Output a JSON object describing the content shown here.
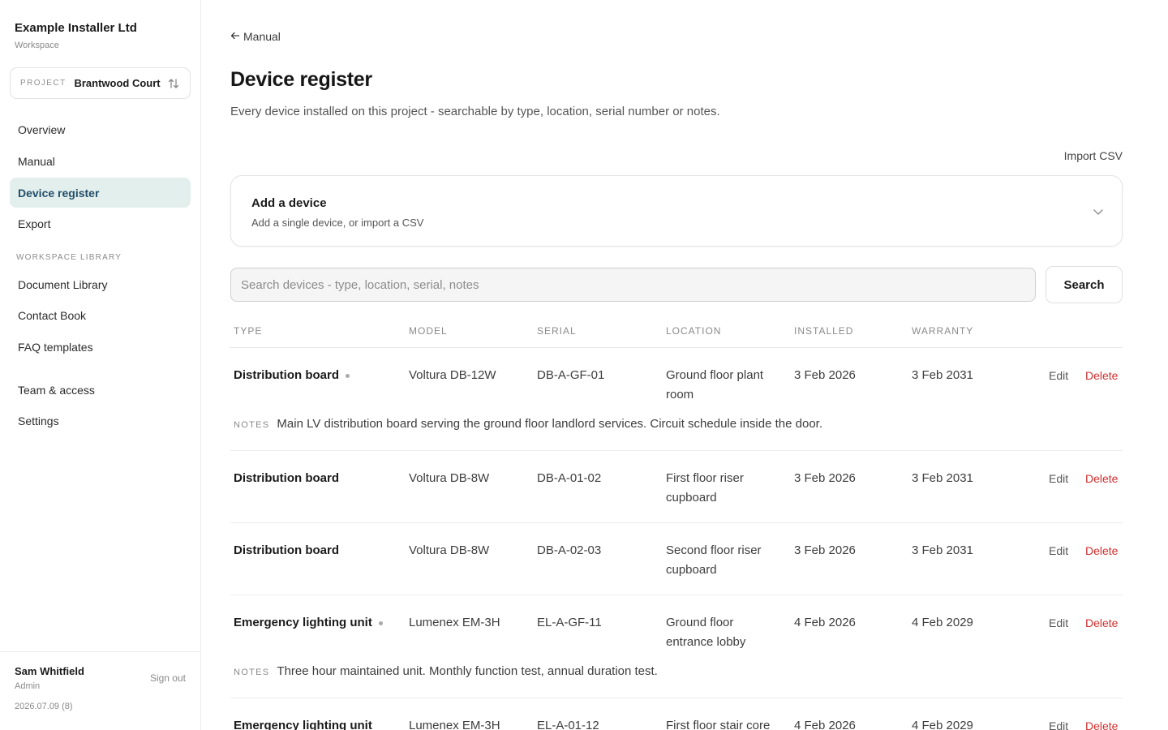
{
  "sidebar": {
    "workspace_name": "Example Installer Ltd",
    "workspace_sub": "Workspace",
    "project_caption": "PROJECT",
    "project_name": "Brantwood Court",
    "nav": [
      {
        "label": "Overview"
      },
      {
        "label": "Manual"
      },
      {
        "label": "Device register",
        "active": true
      },
      {
        "label": "Export"
      }
    ],
    "library_heading": "WORKSPACE LIBRARY",
    "library": [
      {
        "label": "Document Library"
      },
      {
        "label": "Contact Book"
      },
      {
        "label": "FAQ templates"
      }
    ],
    "admin": [
      {
        "label": "Team & access"
      },
      {
        "label": "Settings"
      }
    ],
    "user": {
      "name": "Sam Whitfield",
      "role": "Admin",
      "sign_out": "Sign out",
      "version": "2026.07.09 (8)"
    }
  },
  "main": {
    "back_label": "Manual",
    "title": "Device register",
    "description": "Every device installed on this project - searchable by type, location, serial number or notes.",
    "import_csv": "Import CSV",
    "add_card": {
      "title": "Add a device",
      "subtitle": "Add a single device, or import a CSV"
    },
    "search": {
      "placeholder": "Search devices - type, location, serial, notes",
      "value": "",
      "button": "Search"
    },
    "columns": [
      "TYPE",
      "MODEL",
      "SERIAL",
      "LOCATION",
      "INSTALLED",
      "WARRANTY"
    ],
    "notes_label": "NOTES",
    "edit_label": "Edit",
    "delete_label": "Delete",
    "rows": [
      {
        "type": "Distribution board",
        "has_notes": true,
        "model": "Voltura DB-12W",
        "serial": "DB-A-GF-01",
        "location": "Ground floor plant room",
        "installed": "3 Feb 2026",
        "warranty": "3 Feb 2031",
        "notes": "Main LV distribution board serving the ground floor landlord services. Circuit schedule inside the door."
      },
      {
        "type": "Distribution board",
        "has_notes": false,
        "model": "Voltura DB-8W",
        "serial": "DB-A-01-02",
        "location": "First floor riser cupboard",
        "installed": "3 Feb 2026",
        "warranty": "3 Feb 2031",
        "notes": ""
      },
      {
        "type": "Distribution board",
        "has_notes": false,
        "model": "Voltura DB-8W",
        "serial": "DB-A-02-03",
        "location": "Second floor riser cupboard",
        "installed": "3 Feb 2026",
        "warranty": "3 Feb 2031",
        "notes": ""
      },
      {
        "type": "Emergency lighting unit",
        "has_notes": true,
        "model": "Lumenex EM-3H",
        "serial": "EL-A-GF-11",
        "location": "Ground floor entrance lobby",
        "installed": "4 Feb 2026",
        "warranty": "4 Feb 2029",
        "notes": "Three hour maintained unit. Monthly function test, annual duration test."
      },
      {
        "type": "Emergency lighting unit",
        "has_notes": false,
        "model": "Lumenex EM-3H",
        "serial": "EL-A-01-12",
        "location": "First floor stair core",
        "installed": "4 Feb 2026",
        "warranty": "4 Feb 2029",
        "notes": ""
      }
    ]
  }
}
